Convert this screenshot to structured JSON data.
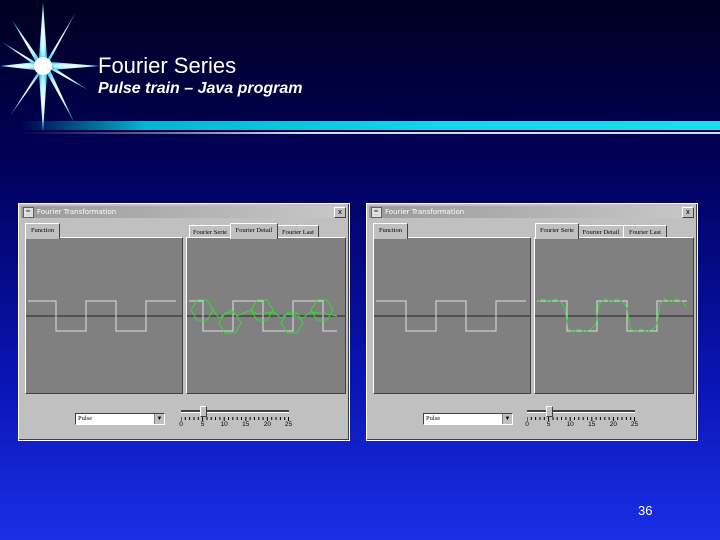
{
  "slide": {
    "title": "Fourier Series",
    "subtitle": "Pulse train – Java program",
    "page_number": "36",
    "colors": {
      "background": "#0a14b4",
      "rule": "#10d8ec",
      "text": "#ffffff"
    }
  },
  "windows": [
    {
      "title": "Fourier Transformation",
      "close_label": "x",
      "left_tab": "Function",
      "right_tabs": [
        "Fourier Serie",
        "Fourier Detail",
        "Fourier Last"
      ],
      "active_right_tab": "Fourier Detail",
      "dropdown_value": "Pulse",
      "slider": {
        "value": 5,
        "min": 0,
        "max": 25,
        "labels": [
          "0",
          "5",
          "10",
          "15",
          "20",
          "25"
        ]
      },
      "plot_color": "#33dd33"
    },
    {
      "title": "Fourier Transformation",
      "close_label": "x",
      "left_tab": "Function",
      "right_tabs": [
        "Fourier Serie",
        "Fourier Detail",
        "Fourier Last"
      ],
      "active_right_tab": "Fourier Serie",
      "dropdown_value": "Pulse",
      "slider": {
        "value": 5,
        "min": 0,
        "max": 25,
        "labels": [
          "0",
          "5",
          "10",
          "15",
          "20",
          "25"
        ]
      },
      "plot_color": "#33dd33"
    }
  ]
}
